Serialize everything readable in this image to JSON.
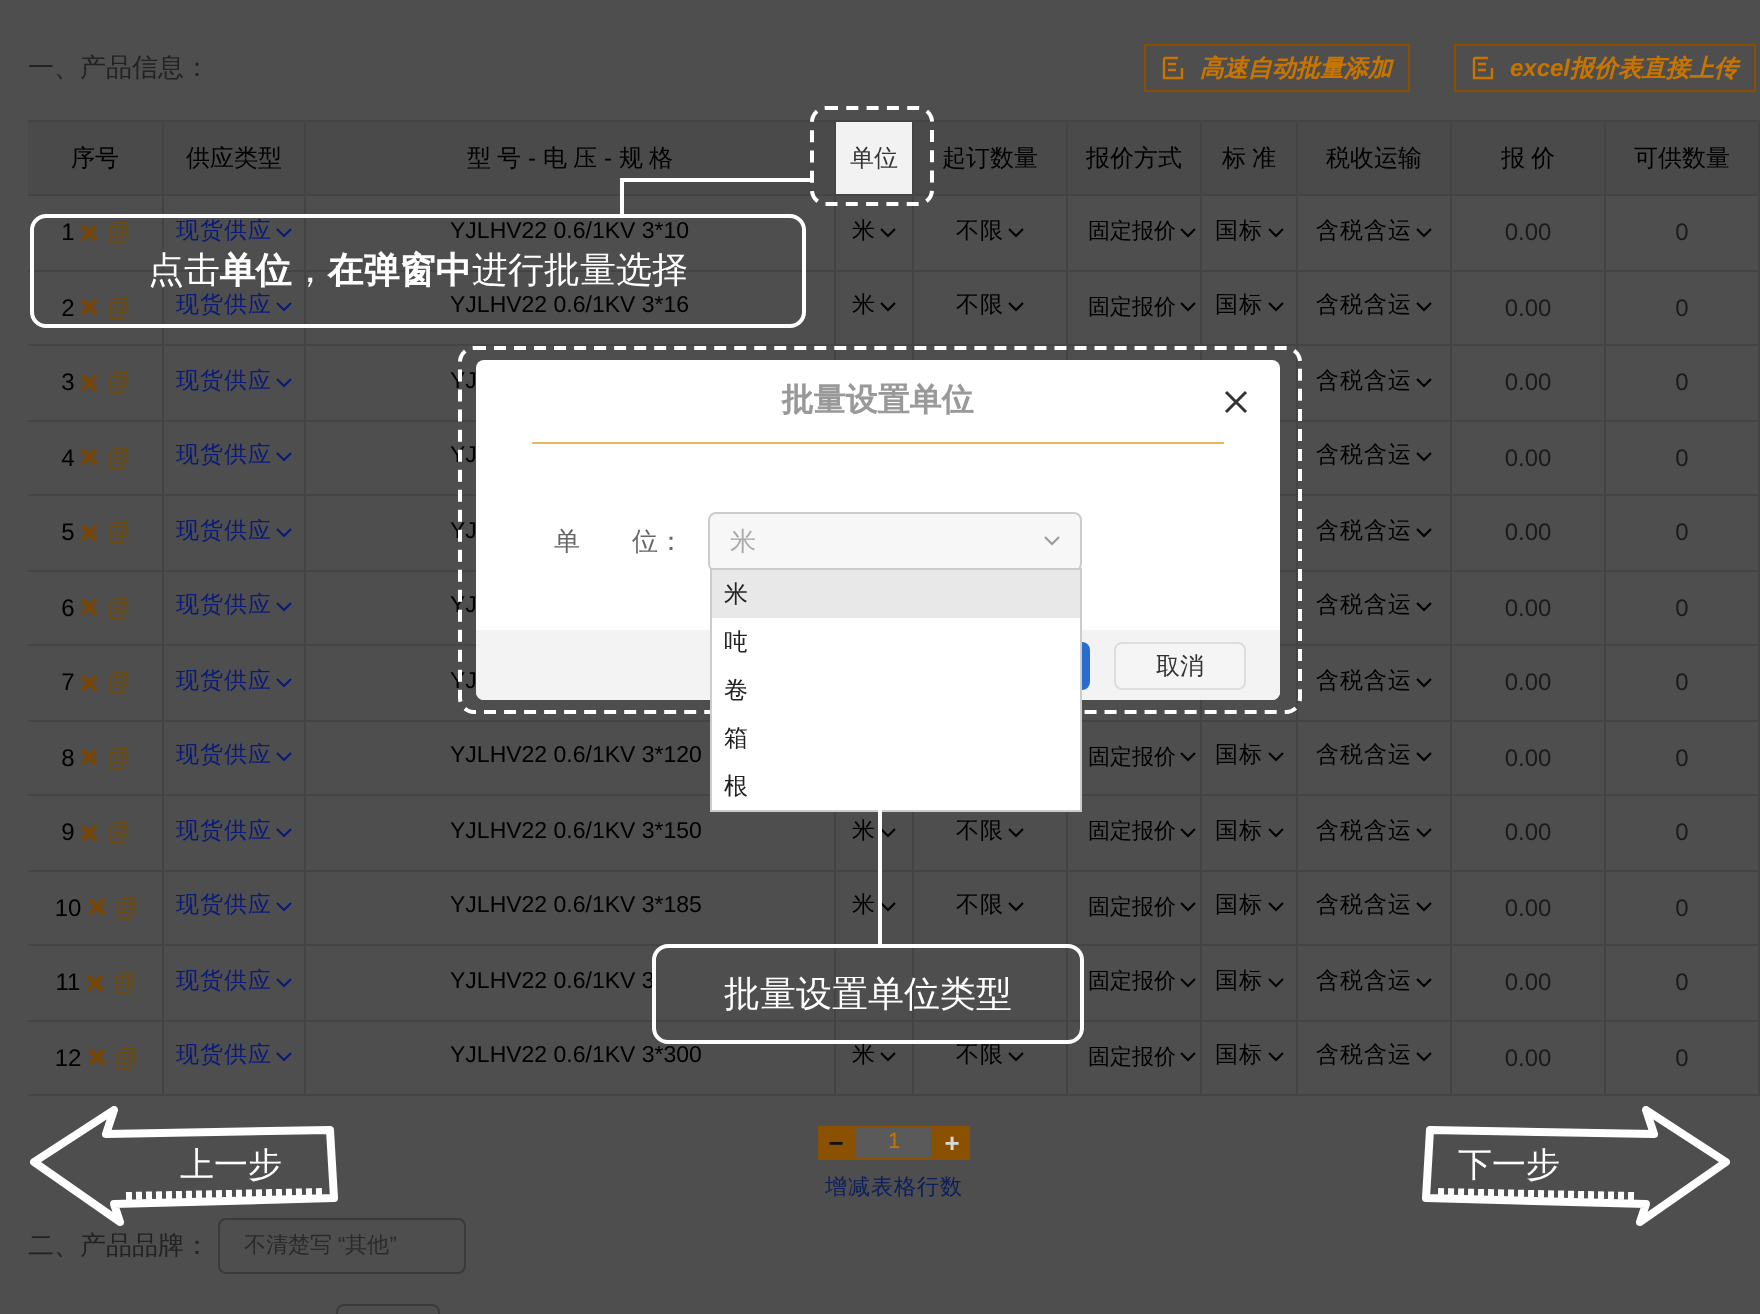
{
  "section_1": {
    "title": "一、产品信息："
  },
  "toolbar_buttons": [
    {
      "label": "高速自动批量添加"
    },
    {
      "label": "excel报价表直接上传"
    }
  ],
  "table": {
    "columns": [
      {
        "label": "序号",
        "highlighted": false
      },
      {
        "label": "供应类型",
        "highlighted": false
      },
      {
        "label": "型 号 - 电 压 - 规 格",
        "highlighted": false
      },
      {
        "label": "单位",
        "highlighted": true
      },
      {
        "label": "起订数量",
        "highlighted": false
      },
      {
        "label": "报价方式",
        "highlighted": false
      },
      {
        "label": "标 准",
        "highlighted": false
      },
      {
        "label": "税收运输",
        "highlighted": false
      },
      {
        "label": "报 价",
        "highlighted": false
      },
      {
        "label": "可供数量",
        "highlighted": false
      }
    ],
    "rows": [
      {
        "seq": "1",
        "supply": "现货供应",
        "model": "YJLHV22 0.6/1KV 3*10",
        "unit": "米",
        "moq": "不限",
        "pricing": "固定报价",
        "standard": "国标",
        "tax": "含税含运",
        "price": "0.00",
        "qty": "0"
      },
      {
        "seq": "2",
        "supply": "现货供应",
        "model": "YJLHV22 0.6/1KV 3*16",
        "unit": "米",
        "moq": "不限",
        "pricing": "固定报价",
        "standard": "国标",
        "tax": "含税含运",
        "price": "0.00",
        "qty": "0"
      },
      {
        "seq": "3",
        "supply": "现货供应",
        "model": "YJ",
        "tax": "含税含运",
        "price": "0.00",
        "qty": "0"
      },
      {
        "seq": "4",
        "supply": "现货供应",
        "model": "YJ",
        "tax": "含税含运",
        "price": "0.00",
        "qty": "0"
      },
      {
        "seq": "5",
        "supply": "现货供应",
        "model": "YJ",
        "tax": "含税含运",
        "price": "0.00",
        "qty": "0"
      },
      {
        "seq": "6",
        "supply": "现货供应",
        "model": "YJ",
        "tax": "含税含运",
        "price": "0.00",
        "qty": "0"
      },
      {
        "seq": "7",
        "supply": "现货供应",
        "model": "YJ",
        "tax": "含税含运",
        "price": "0.00",
        "qty": "0"
      },
      {
        "seq": "8",
        "supply": "现货供应",
        "model": "YJLHV22 0.6/1KV 3*120",
        "pricing": "固定报价",
        "standard": "国标",
        "tax": "含税含运",
        "price": "0.00",
        "qty": "0"
      },
      {
        "seq": "9",
        "supply": "现货供应",
        "model": "YJLHV22 0.6/1KV 3*150",
        "unit": "米",
        "moq": "不限",
        "pricing": "固定报价",
        "standard": "国标",
        "tax": "含税含运",
        "price": "0.00",
        "qty": "0"
      },
      {
        "seq": "10",
        "supply": "现货供应",
        "model": "YJLHV22 0.6/1KV 3*185",
        "unit": "米",
        "moq": "不限",
        "pricing": "固定报价",
        "standard": "国标",
        "tax": "含税含运",
        "price": "0.00",
        "qty": "0"
      },
      {
        "seq": "11",
        "supply": "现货供应",
        "model": "YJLHV22 0.6/1KV 3",
        "pricing": "固定报价",
        "standard": "国标",
        "tax": "含税含运",
        "price": "0.00",
        "qty": "0"
      },
      {
        "seq": "12",
        "supply": "现货供应",
        "model": "YJLHV22 0.6/1KV 3*300",
        "unit": "米",
        "moq": "不限",
        "pricing": "固定报价",
        "standard": "国标",
        "tax": "含税含运",
        "price": "0.00",
        "qty": "0"
      }
    ]
  },
  "pager": {
    "minus": "−",
    "value": "1",
    "plus": "+",
    "caption": "增减表格行数"
  },
  "section_2": {
    "title": "二、产品品牌：",
    "placeholder": "不清楚写 “其他”"
  },
  "dialog": {
    "title": "批量设置单位",
    "field_label": "单　　位：",
    "field_value": "米",
    "cancel": "取消",
    "options": [
      {
        "label": "米",
        "selected": true
      },
      {
        "label": "吨",
        "selected": false
      },
      {
        "label": "卷",
        "selected": false
      },
      {
        "label": "箱",
        "selected": false
      },
      {
        "label": "根",
        "selected": false
      }
    ]
  },
  "callouts": [
    {
      "text": "点击**单位**，**在弹窗中**进行批量选择"
    },
    {
      "text": "批量设置单位类型"
    }
  ],
  "nav": {
    "previous": "上一步",
    "next": "下一步"
  }
}
